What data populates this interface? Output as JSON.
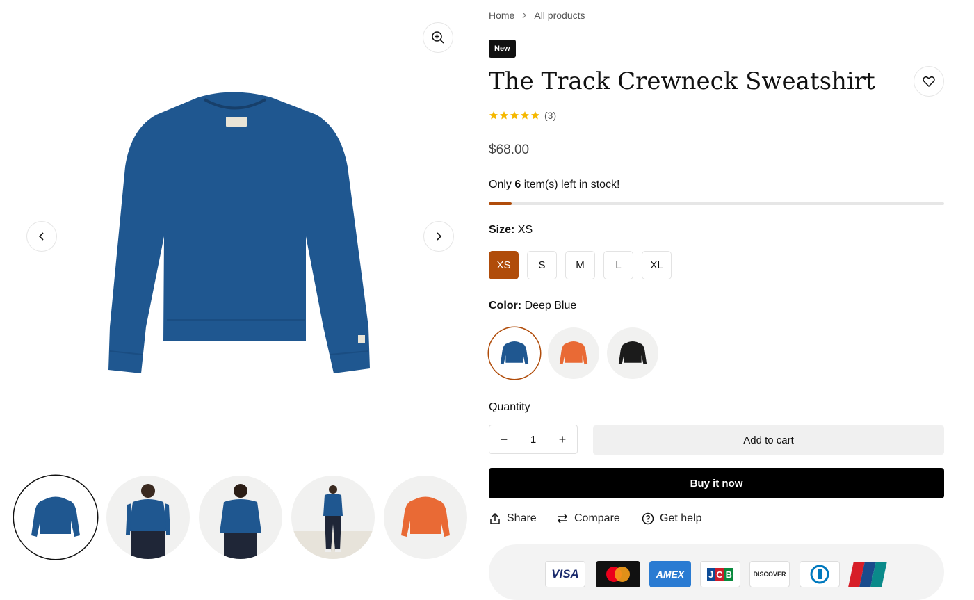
{
  "breadcrumb": {
    "home": "Home",
    "current": "All products"
  },
  "product": {
    "badge": "New",
    "title": "The Track Crewneck Sweatshirt",
    "rating": 5,
    "review_count": "(3)",
    "price": "$68.00",
    "stock": {
      "prefix": "Only ",
      "count": "6",
      "suffix": " item(s) left in stock!",
      "level": 0.05
    },
    "size": {
      "label": "Size:",
      "selected": "XS",
      "options": [
        "XS",
        "S",
        "M",
        "L",
        "XL"
      ]
    },
    "color": {
      "label": "Color:",
      "selected": "Deep Blue",
      "options": [
        "Deep Blue",
        "Orange",
        "Black"
      ],
      "swatches": [
        "#1f5790",
        "#e96a35",
        "#1b1b1b"
      ]
    },
    "quantity": {
      "label": "Quantity",
      "value": "1",
      "minus": "−",
      "plus": "+"
    },
    "add_to_cart": "Add to cart",
    "buy_now": "Buy it now"
  },
  "actions": {
    "share": "Share",
    "compare": "Compare",
    "help": "Get help"
  },
  "payments": {
    "visa": "VISA",
    "mastercard": "mastercard",
    "amex": "AMEX",
    "jcb": "JCB",
    "discover": "DISCOVER",
    "diners": "Diners",
    "unionpay": "UnionPay"
  },
  "colors": {
    "accent": "#b04c0a",
    "product_blue": "#1f5790",
    "star": "#f5b800"
  },
  "icons": [
    "zoom-in-icon",
    "chevron-left-icon",
    "chevron-right-icon",
    "heart-icon",
    "star-icon",
    "share-icon",
    "compare-icon",
    "help-icon"
  ]
}
